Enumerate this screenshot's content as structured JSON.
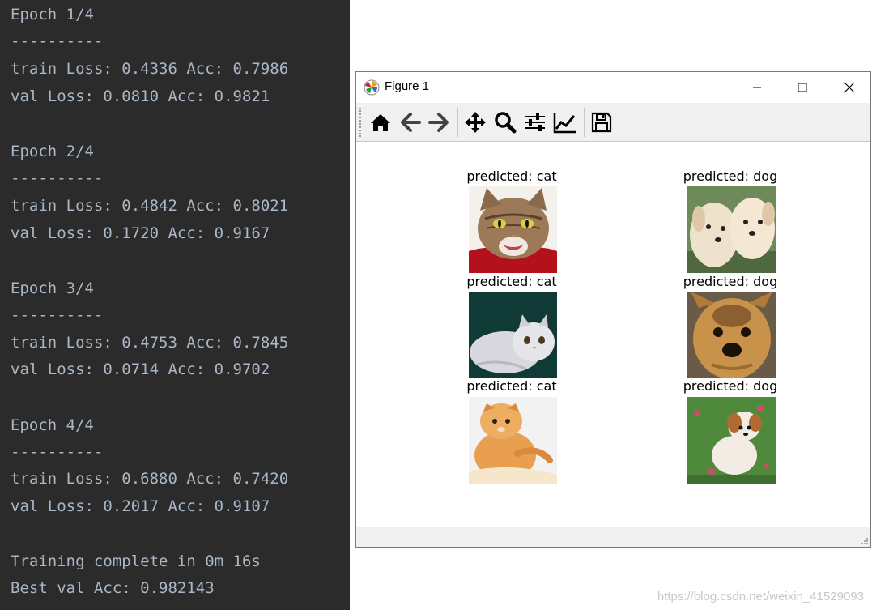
{
  "console": {
    "lines": [
      "Epoch 1/4",
      "----------",
      "train Loss: 0.4336 Acc: 0.7986",
      "val Loss: 0.0810 Acc: 0.9821",
      "",
      "Epoch 2/4",
      "----------",
      "train Loss: 0.4842 Acc: 0.8021",
      "val Loss: 0.1720 Acc: 0.9167",
      "",
      "Epoch 3/4",
      "----------",
      "train Loss: 0.4753 Acc: 0.7845",
      "val Loss: 0.0714 Acc: 0.9702",
      "",
      "Epoch 4/4",
      "----------",
      "train Loss: 0.6880 Acc: 0.7420",
      "val Loss: 0.2017 Acc: 0.9107",
      "",
      "Training complete in 0m 16s",
      "Best val Acc: 0.982143"
    ]
  },
  "figure": {
    "title": "Figure 1",
    "toolbar": [
      "home-icon",
      "back-arrow-icon",
      "forward-arrow-icon",
      "pan-icon",
      "zoom-icon",
      "subplots-icon",
      "edit-axis-icon",
      "save-icon"
    ],
    "predictions": [
      {
        "caption": "predicted: cat",
        "subject": "cat-tabby-on-red"
      },
      {
        "caption": "predicted: dog",
        "subject": "two-puppies"
      },
      {
        "caption": "predicted: cat",
        "subject": "grey-british-shorthair"
      },
      {
        "caption": "predicted: dog",
        "subject": "yorkshire-terrier"
      },
      {
        "caption": "predicted: cat",
        "subject": "orange-scottish-fold"
      },
      {
        "caption": "predicted: dog",
        "subject": "puppy-on-grass"
      }
    ]
  },
  "watermark": "https://blog.csdn.net/weixin_41529093",
  "colors": {
    "console_bg": "#2b2b2b",
    "console_text": "#a9b7c6"
  }
}
